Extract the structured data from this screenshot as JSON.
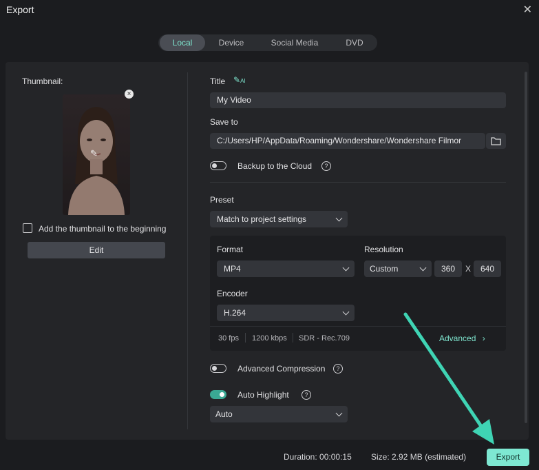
{
  "window": {
    "title": "Export"
  },
  "tabs": [
    {
      "label": "Local",
      "active": true
    },
    {
      "label": "Device",
      "active": false
    },
    {
      "label": "Social Media",
      "active": false
    },
    {
      "label": "DVD",
      "active": false
    }
  ],
  "thumbnail": {
    "label": "Thumbnail:",
    "add_to_beginning_label": "Add the thumbnail to the beginning",
    "add_to_beginning_checked": false,
    "edit_label": "Edit"
  },
  "form": {
    "title_label": "Title",
    "title_ai_badge": "AI",
    "title_value": "My Video",
    "save_to_label": "Save to",
    "save_to_value": "C:/Users/HP/AppData/Roaming/Wondershare/Wondershare Filmor",
    "backup_label": "Backup to the Cloud",
    "backup_on": false,
    "preset_label": "Preset",
    "preset_value": "Match to project settings",
    "format_label": "Format",
    "format_value": "MP4",
    "resolution_label": "Resolution",
    "resolution_value": "Custom",
    "res_width": "360",
    "res_x": "X",
    "res_height": "640",
    "encoder_label": "Encoder",
    "encoder_value": "H.264",
    "info_fps": "30 fps",
    "info_bitrate": "1200 kbps",
    "info_color": "SDR - Rec.709",
    "advanced_label": "Advanced",
    "advanced_compression_label": "Advanced Compression",
    "advanced_compression_on": false,
    "auto_highlight_label": "Auto Highlight",
    "auto_highlight_on": true,
    "auto_highlight_value": "Auto"
  },
  "footer": {
    "duration_label": "Duration:",
    "duration_value": "00:00:15",
    "size_label": "Size:",
    "size_value": "2.92 MB",
    "size_note": "(estimated)",
    "export_label": "Export"
  },
  "colors": {
    "accent": "#7ee8d2",
    "background": "#1b1c1f",
    "panel": "#242528",
    "arrow": "#3fd4b4"
  }
}
